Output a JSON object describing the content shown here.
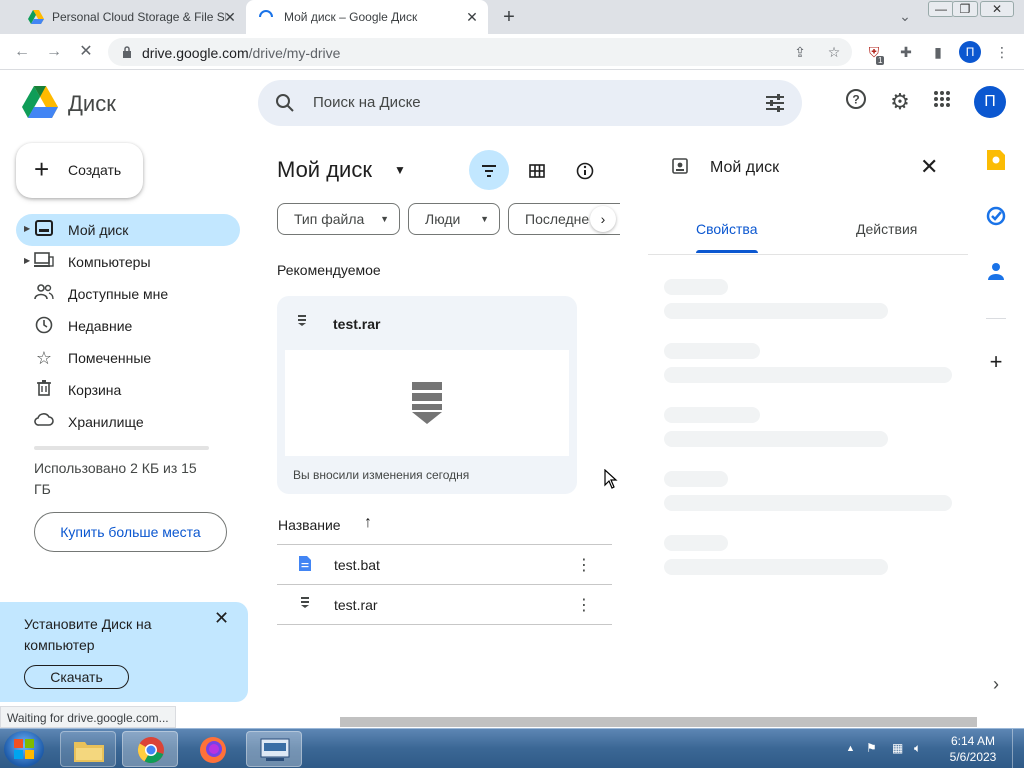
{
  "browser": {
    "tabs": [
      {
        "title": "Personal Cloud Storage & File Sh",
        "active": false
      },
      {
        "title": "Мой диск – Google Диск",
        "active": true
      }
    ],
    "url_host": "drive.google.com",
    "url_path": "/drive/my-drive",
    "profile_initial": "П",
    "extension_badge": "1",
    "status_text": "Waiting for drive.google.com..."
  },
  "header": {
    "app_name": "Диск",
    "search_placeholder": "Поиск на Диске",
    "profile_initial": "П"
  },
  "sidebar": {
    "create_label": "Создать",
    "items": [
      {
        "label": "Мой диск",
        "icon": "drive-icon",
        "active": true,
        "expandable": true
      },
      {
        "label": "Компьютеры",
        "icon": "computer-icon",
        "active": false,
        "expandable": true
      },
      {
        "label": "Доступные мне",
        "icon": "people-icon",
        "active": false,
        "expandable": false
      },
      {
        "label": "Недавние",
        "icon": "clock-icon",
        "active": false,
        "expandable": false
      },
      {
        "label": "Помеченные",
        "icon": "star-icon",
        "active": false,
        "expandable": false
      },
      {
        "label": "Корзина",
        "icon": "trash-icon",
        "active": false,
        "expandable": false
      },
      {
        "label": "Хранилище",
        "icon": "cloud-icon",
        "active": false,
        "expandable": false
      }
    ],
    "storage_text": "Использовано 2 КБ из 15 ГБ",
    "buy_storage_label": "Купить больше места",
    "install_banner": {
      "message": "Установите Диск на компьютер",
      "download_label": "Скачать"
    }
  },
  "main": {
    "title": "Мой диск",
    "filters": [
      "Тип файла",
      "Люди",
      "Последне"
    ],
    "suggested_heading": "Рекомендуемое",
    "suggested_file": {
      "name": "test.rar",
      "activity": "Вы вносили изменения сегодня"
    },
    "list_header": "Название",
    "files": [
      {
        "name": "test.bat",
        "icon": "document-icon"
      },
      {
        "name": "test.rar",
        "icon": "archive-icon"
      }
    ]
  },
  "details": {
    "title": "Мой диск",
    "tabs": [
      "Свойства",
      "Действия"
    ]
  },
  "taskbar": {
    "time": "6:14 AM",
    "date": "5/6/2023"
  },
  "colors": {
    "accent": "#0b57d0",
    "selected_bg": "#c2e7ff",
    "search_bg": "#e9eef6",
    "card_bg": "#f0f4f9"
  }
}
